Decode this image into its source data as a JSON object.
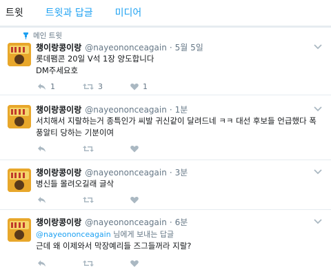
{
  "tabs": [
    {
      "label": "트윗",
      "active": true
    },
    {
      "label": "트윗과 답글",
      "active": false
    },
    {
      "label": "미디어",
      "active": false
    }
  ],
  "pinned_label": "메인 트윗",
  "colors": {
    "accent": "#1da1f2",
    "secondary_text": "#657786",
    "action_icon": "#aab8c2",
    "divider": "#e6ecf0"
  },
  "tweets": [
    {
      "name": "챙이랑콩이랑",
      "handle": "@nayeononceagain",
      "time": "5월 5일",
      "text": "롯데팸콘 20일 V석 1장 양도합니다\nDM주세요호",
      "counts": {
        "reply": "1",
        "retweet": "3",
        "like": "1"
      }
    },
    {
      "name": "챙이랑콩이랑",
      "handle": "@nayeononceagain",
      "time": "1분",
      "text": "서치해서 지랄하는거 종특인가 씨발 귀신같이 달려드네 ㅋㅋ 대선 후보들 언급했다 폭풍알티 당하는 기분이여",
      "counts": {
        "reply": "",
        "retweet": "",
        "like": ""
      }
    },
    {
      "name": "챙이랑콩이랑",
      "handle": "@nayeononceagain",
      "time": "3분",
      "text": "병신들 몰려오길래 글삭",
      "counts": {
        "reply": "",
        "retweet": "",
        "like": ""
      }
    },
    {
      "name": "챙이랑콩이랑",
      "handle": "@nayeononceagain",
      "time": "6분",
      "reply_to": {
        "handle": "@nayeononceagain",
        "suffix": " 님에게 보내는 답글"
      },
      "text": "근데 왜 이제와서 막장예리들 즈그들꺼라 지랄?",
      "counts": {
        "reply": "",
        "retweet": "",
        "like": ""
      }
    }
  ],
  "sep": "·"
}
